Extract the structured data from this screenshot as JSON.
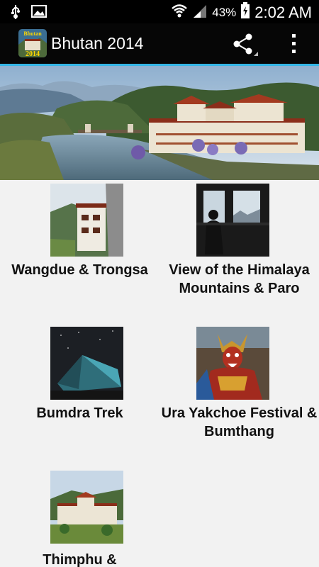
{
  "status_bar": {
    "battery_percent": "43%",
    "time": "2:02 AM",
    "icons": [
      "usb-icon",
      "image-icon",
      "wifi-icon",
      "signal-icon",
      "battery-charging-icon"
    ]
  },
  "action_bar": {
    "app_icon_text": "Bhutan",
    "app_icon_year": "2014",
    "title": "Bhutan 2014",
    "share_icon": "share-icon",
    "overflow_icon": "overflow-menu-icon"
  },
  "albums": [
    {
      "title": "Wangdue & Trongsa"
    },
    {
      "title": "View of the Himalaya Mountains & Paro"
    },
    {
      "title": "Bumdra Trek"
    },
    {
      "title": "Ura Yakchoe Festival & Bumthang"
    },
    {
      "title": "Thimphu &"
    }
  ],
  "colors": {
    "accent": "#33b5e5",
    "action_bar": "#060606",
    "background": "#f2f2f2"
  }
}
